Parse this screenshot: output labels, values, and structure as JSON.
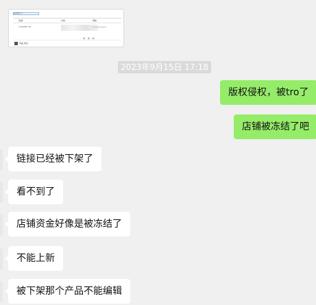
{
  "shared_card": {
    "header_tab": "联系我们 了",
    "col_left": "店铺",
    "col_mid": "价格",
    "col_right": "规格",
    "row_left": "1234567 30",
    "footer": "商品 信息"
  },
  "timestamp": "2023年9月15日 17:18",
  "messages": [
    {
      "side": "me",
      "text": "版权侵权，被tro了"
    },
    {
      "side": "me",
      "text": "店铺被冻结了吧"
    },
    {
      "side": "them",
      "text": "链接已经被下架了"
    },
    {
      "side": "them",
      "text": "看不到了"
    },
    {
      "side": "them",
      "text": "店铺资金好像是被冻结了"
    },
    {
      "side": "them",
      "text": "不能上新"
    },
    {
      "side": "them",
      "text": "被下架那个产品不能编辑"
    }
  ],
  "colors": {
    "my_bubble": "#95ec69",
    "their_bubble": "#ffffff",
    "background": "#f0f0f0",
    "timestamp_bg": "#dadada"
  }
}
